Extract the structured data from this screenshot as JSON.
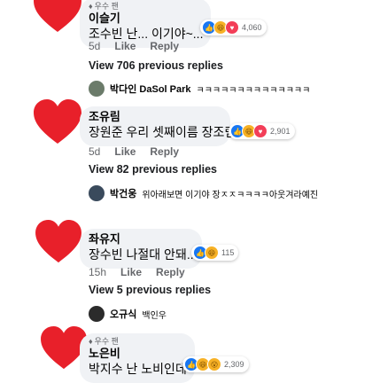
{
  "comments": [
    {
      "badge": "우수 팬",
      "name": "이슬기",
      "text": "조수빈 난... 이기야~...",
      "reaction_count": "4,060",
      "time": "5d",
      "like_label": "Like",
      "reply_label": "Reply",
      "view_replies": "View 706 previous replies",
      "reply_name": "박다인 DaSol Park",
      "reply_text": "ㅋㅋㅋㅋㅋㅋㅋㅋㅋㅋㅋㅋㅋㅋ"
    },
    {
      "badge": "",
      "name": "조유림",
      "text": "장원준 우리 셋째이름 장조림",
      "reaction_count": "2,901",
      "time": "5d",
      "like_label": "Like",
      "reply_label": "Reply",
      "view_replies": "View 82 previous replies",
      "reply_name": "박건웅",
      "reply_text": "위아래보면 이기야 장ㅈㅈㅋㅋㅋㅋ아웃겨라예진"
    },
    {
      "badge": "",
      "name": "좌유지",
      "text": "장수빈 나절대 안돼...",
      "reaction_count": "115",
      "time": "15h",
      "like_label": "Like",
      "reply_label": "Reply",
      "view_replies": "View 5 previous replies",
      "reply_name": "오규식",
      "reply_text": "백인우"
    },
    {
      "badge": "우수 팬",
      "name": "노은비",
      "text": "박지수 난 노비인데",
      "reaction_count": "2,309"
    }
  ],
  "colors": {
    "heart": "#e8202a",
    "like": "#1877f2",
    "love": "#f33e58",
    "haha": "#f7b125"
  }
}
